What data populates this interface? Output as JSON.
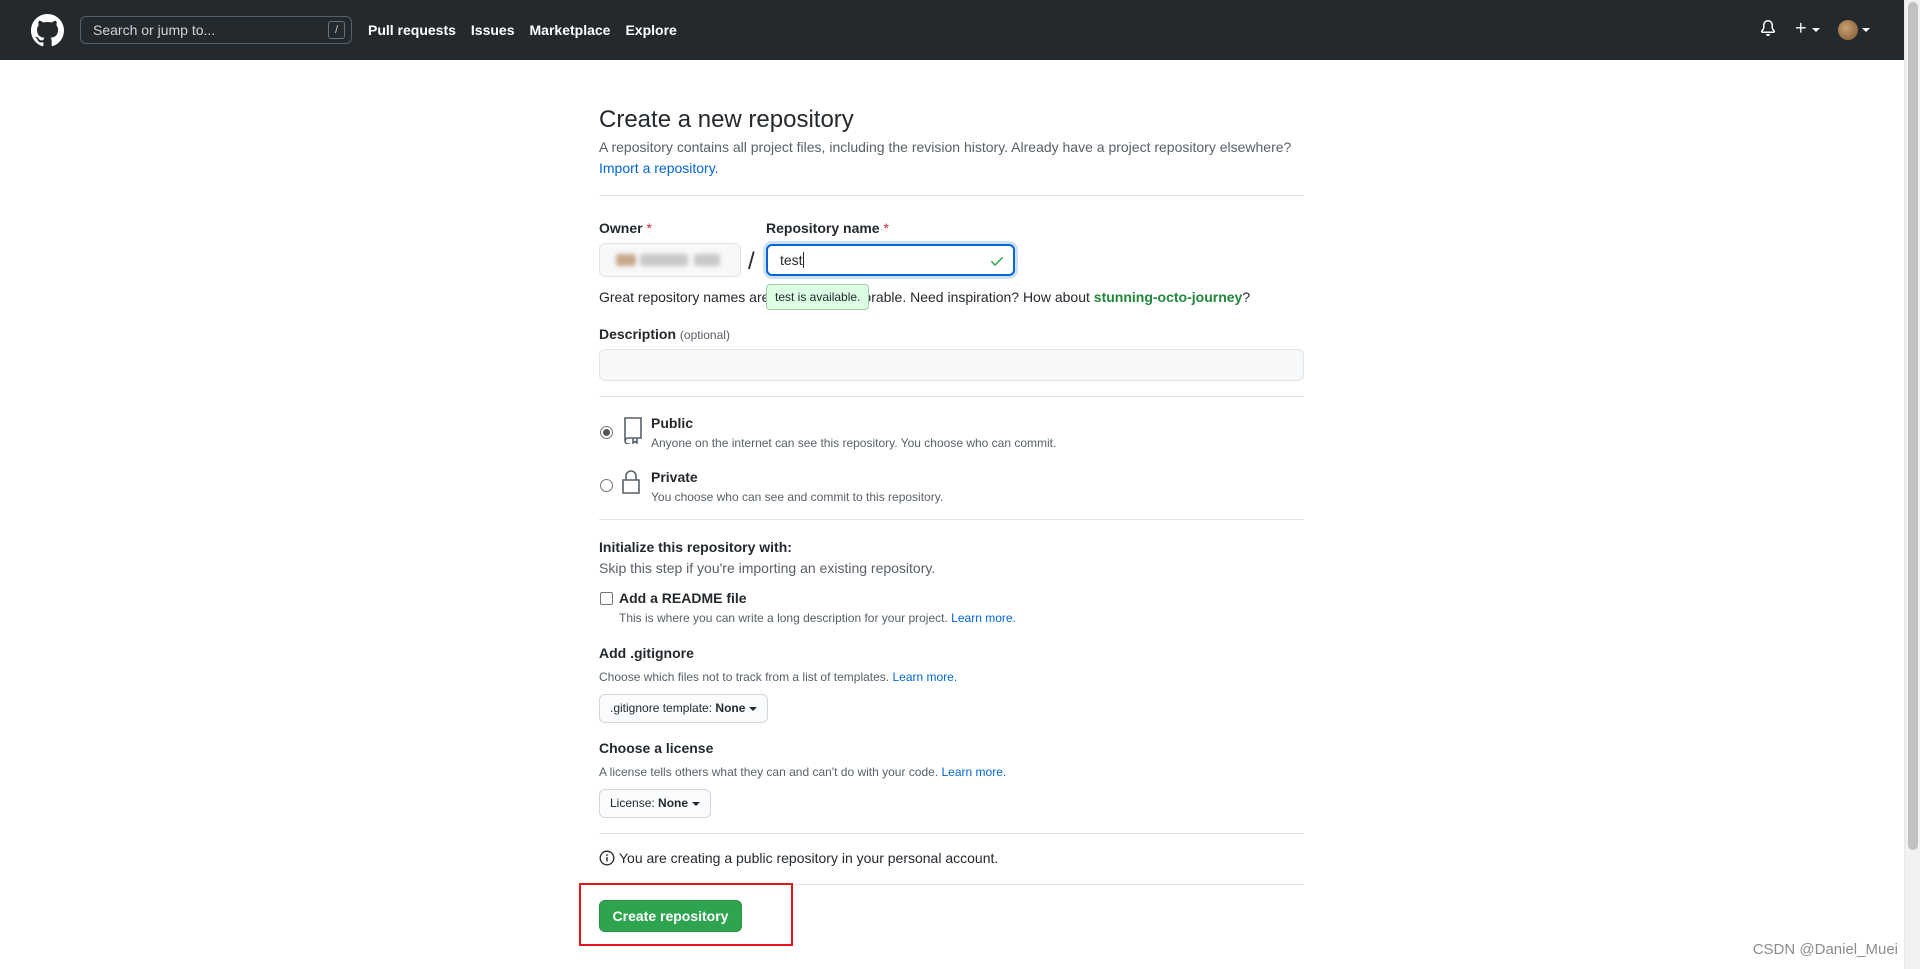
{
  "header": {
    "search_placeholder": "Search or jump to...",
    "search_shortcut": "/",
    "nav": [
      "Pull requests",
      "Issues",
      "Marketplace",
      "Explore"
    ],
    "icons": [
      "github-logo-icon",
      "bell-icon",
      "plus-icon",
      "avatar"
    ]
  },
  "page": {
    "title": "Create a new repository",
    "subtitle": "A repository contains all project files, including the revision history. Already have a project repository elsewhere?",
    "import_link": "Import a repository."
  },
  "form": {
    "owner_label": "Owner",
    "required_mark": "*",
    "slash": "/",
    "repo_label": "Repository name",
    "repo_value": "test",
    "availability_tooltip": "test is available.",
    "hint_before": "Great repository names are short and memorable. Need inspiration? How about ",
    "hint_visible_start": "Great repository names are",
    "hint_visible_end": "orable. Need inspiration? How about ",
    "hint_suggestion": "stunning-octo-journey",
    "hint_end": "?",
    "description_label": "Description",
    "description_optional": "(optional)",
    "description_value": ""
  },
  "visibility": {
    "public_title": "Public",
    "public_desc": "Anyone on the internet can see this repository. You choose who can commit.",
    "private_title": "Private",
    "private_desc": "You choose who can see and commit to this repository.",
    "selected": "Public"
  },
  "init": {
    "title": "Initialize this repository with:",
    "note": "Skip this step if you're importing an existing repository.",
    "readme_label": "Add a README file",
    "readme_desc": "This is where you can write a long description for your project.",
    "learn_more": "Learn more.",
    "readme_checked": false,
    "gitignore_title": "Add .gitignore",
    "gitignore_desc": "Choose which files not to track from a list of templates.",
    "gitignore_select_prefix": ".gitignore template:",
    "gitignore_select_value": "None",
    "license_title": "Choose a license",
    "license_desc": "A license tells others what they can and can't do with your code.",
    "license_select_prefix": "License:",
    "license_select_value": "None"
  },
  "footer": {
    "info": "You are creating a public repository in your personal account.",
    "create_button": "Create repository",
    "watermark": "CSDN @Daniel_Muei"
  },
  "colors": {
    "header_bg": "#24292e",
    "primary_green": "#2ea44f",
    "link_blue": "#0366d6",
    "highlight_red": "#e0171c"
  }
}
